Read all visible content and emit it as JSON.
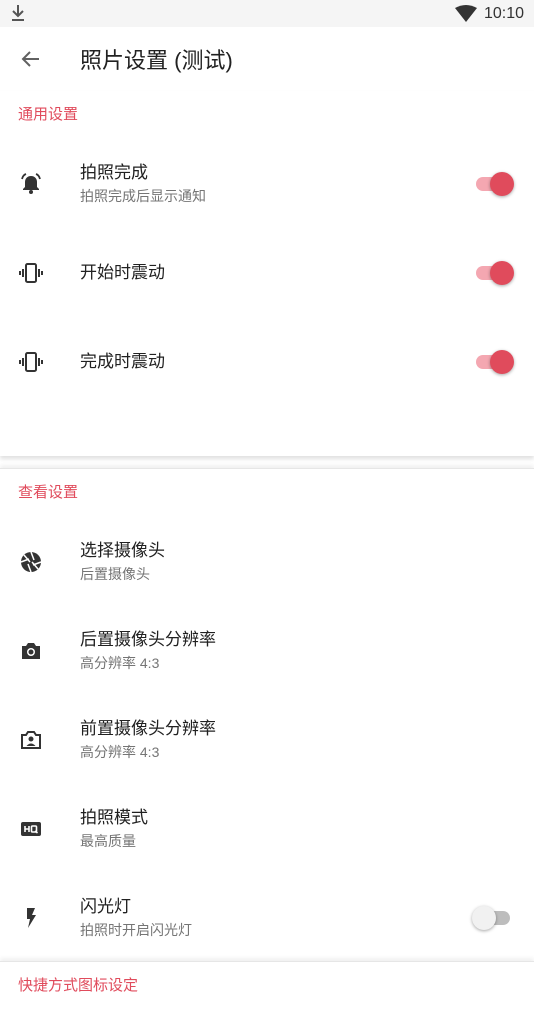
{
  "status_bar": {
    "time": "10:10",
    "download_icon": "download-icon",
    "wifi_icon": "wifi-icon"
  },
  "app_bar": {
    "title": "照片设置 (测试)",
    "back_icon": "arrow-back-icon"
  },
  "sections": [
    {
      "header": "通用设置",
      "items": [
        {
          "title": "拍照完成",
          "subtitle": "拍照完成后显示通知",
          "icon": "alarm-bell-icon",
          "switch": true
        },
        {
          "title": "开始时震动",
          "subtitle": "",
          "icon": "vibrate-icon",
          "switch": true
        },
        {
          "title": "完成时震动",
          "subtitle": "",
          "icon": "vibrate-icon",
          "switch": true
        }
      ]
    },
    {
      "header": "查看设置",
      "items": [
        {
          "title": "选择摄像头",
          "subtitle": "后置摄像头",
          "icon": "camera-shutter-icon"
        },
        {
          "title": "后置摄像头分辨率",
          "subtitle": "高分辨率 4:3",
          "icon": "camera-icon"
        },
        {
          "title": "前置摄像头分辨率",
          "subtitle": "高分辨率 4:3",
          "icon": "camera-front-icon"
        },
        {
          "title": "拍照模式",
          "subtitle": "最高质量",
          "icon": "hq-icon"
        },
        {
          "title": "闪光灯",
          "subtitle": "拍照时开启闪光灯",
          "icon": "flash-icon",
          "switch": false
        }
      ]
    },
    {
      "header": "快捷方式图标设定"
    }
  ],
  "colors": {
    "accent": "#e04b5c",
    "accent_light": "#f4a7b1"
  }
}
